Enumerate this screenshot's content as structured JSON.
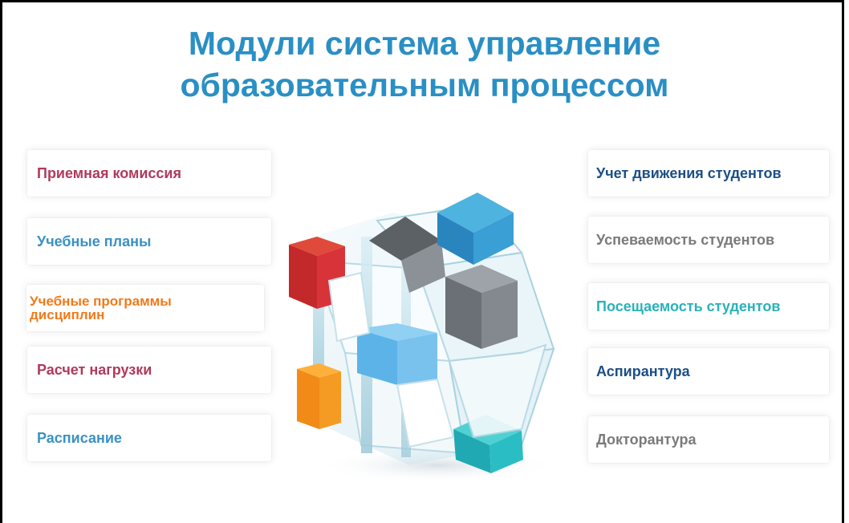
{
  "title": "Модули система управление\nобразовательным процессом",
  "left_modules": [
    {
      "label": "Приемная комиссия",
      "color": "#b03a5b"
    },
    {
      "label": "Учебные планы",
      "color": "#3a91c4"
    },
    {
      "label": "Учебные программы\nдисциплин",
      "color": "#f07a1a"
    },
    {
      "label": "Расчет нагрузки",
      "color": "#b03a5b"
    },
    {
      "label": "Расписание",
      "color": "#3a91c4"
    }
  ],
  "right_modules": [
    {
      "label": "Учет движения студентов",
      "color": "#1c4f86"
    },
    {
      "label": "Успеваемость студентов",
      "color": "#7a7a7a"
    },
    {
      "label": "Посещаемость студентов",
      "color": "#2ab2b8"
    },
    {
      "label": "Аспирантура",
      "color": "#1c4f86"
    },
    {
      "label": "Докторантура",
      "color": "#7a7a7a"
    }
  ],
  "title_color": "#2a8fc4"
}
